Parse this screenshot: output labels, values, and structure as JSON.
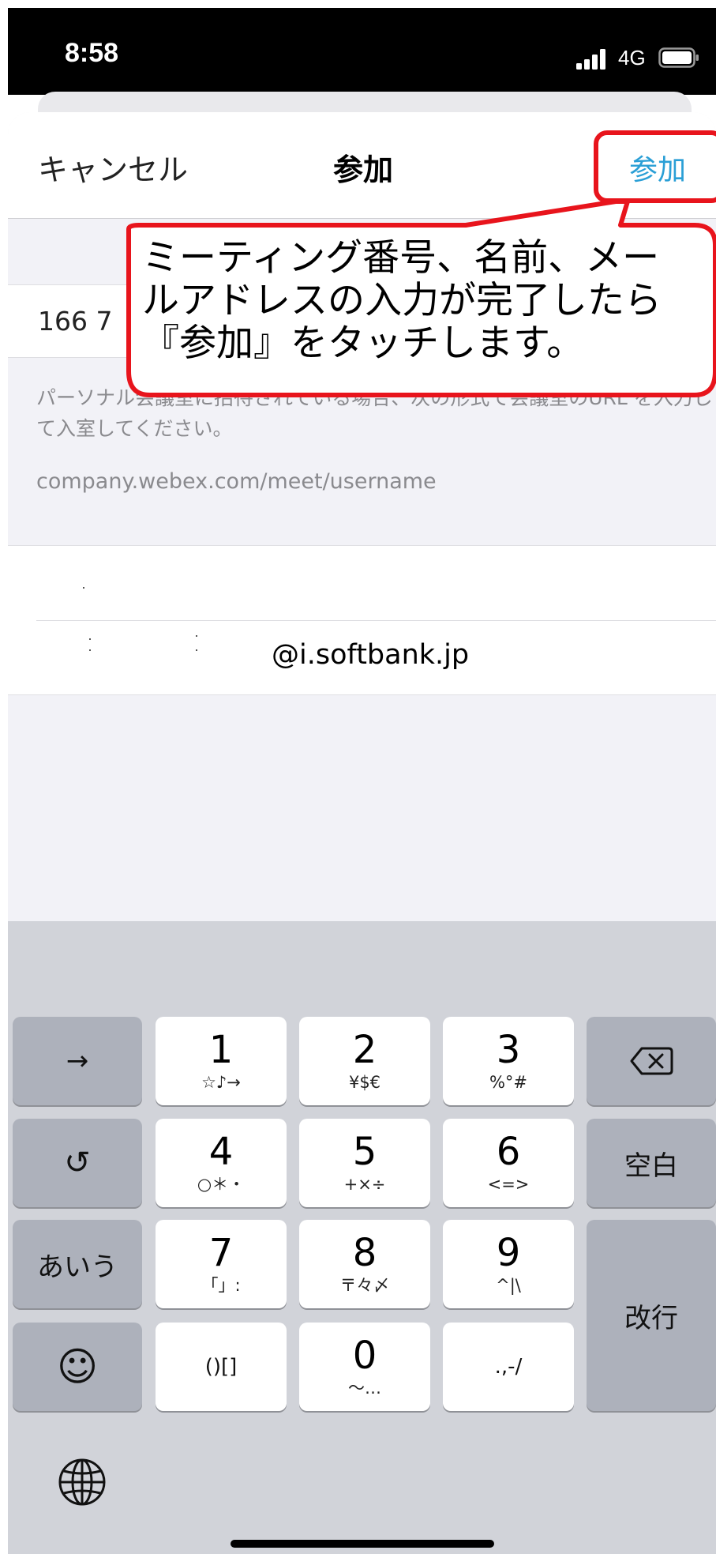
{
  "status_bar": {
    "time": "8:58",
    "network": "4G"
  },
  "nav": {
    "cancel": "キャンセル",
    "title": "参加",
    "join": "参加"
  },
  "form": {
    "meeting_value": "166 7",
    "helper_text_1": "パーソナル会議室に招待されている場合、次の形式で会議室のURL を入力して入室してください。",
    "helper_text_2": "company.webex.com/meet/username",
    "email_value": "@i.softbank.jp"
  },
  "callout": {
    "line1": "ミーティング番号、名前、メー",
    "line2": "ルアドレスの入力が完了したら",
    "line3": "『参加』をタッチします。",
    "color": "#e8141c"
  },
  "keyboard": {
    "arrow": "→",
    "undo": "↺",
    "kana": "あいう",
    "emoji": "☺",
    "globe": "globe-icon",
    "delete": "delete-icon",
    "k1": {
      "main": "1",
      "sub": "☆♪→"
    },
    "k2": {
      "main": "2",
      "sub": "¥$€"
    },
    "k3": {
      "main": "3",
      "sub": "%°#"
    },
    "k4": {
      "main": "4",
      "sub": "○＊・"
    },
    "k5": {
      "main": "5",
      "sub": "+×÷"
    },
    "k6": {
      "main": "6",
      "sub": "<=>"
    },
    "k7": {
      "main": "7",
      "sub": "「」:"
    },
    "k8": {
      "main": "8",
      "sub": "〒々〆"
    },
    "k9": {
      "main": "9",
      "sub": "^|\\"
    },
    "paren": "()[]",
    "k0": {
      "main": "0",
      "sub": "〜…"
    },
    "punct": ".,-/",
    "space": "空白",
    "enter": "改行"
  }
}
